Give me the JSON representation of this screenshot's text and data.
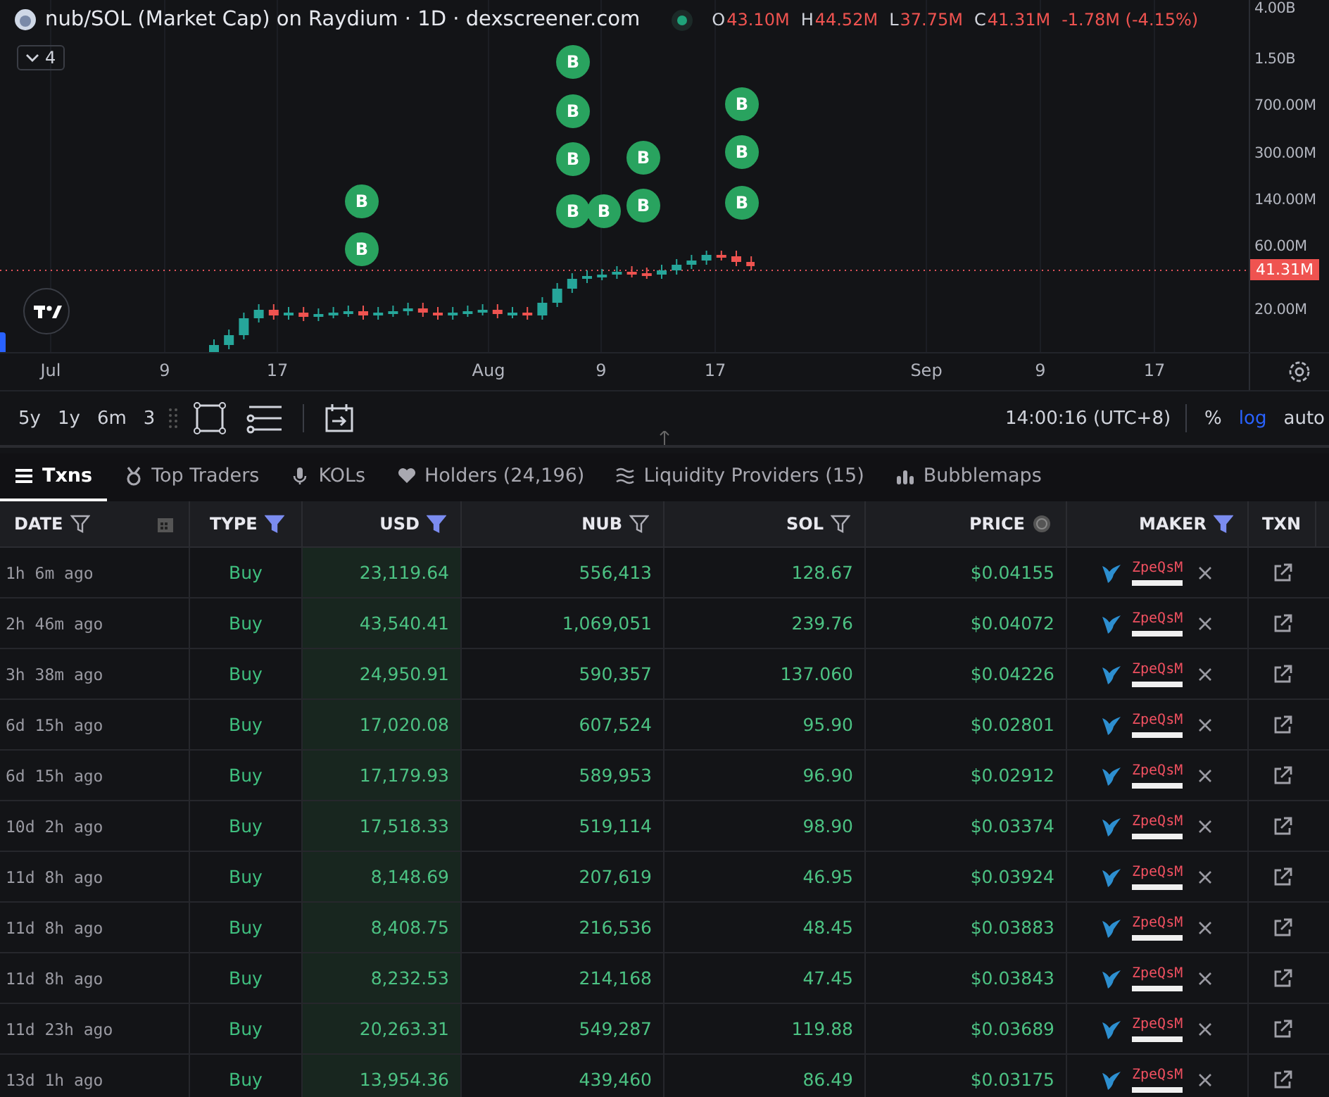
{
  "chart": {
    "legend": {
      "title": "nub/SOL (Market Cap) on Raydium · 1D · dexscreener.com",
      "live": true,
      "ohlc": [
        {
          "label": "O",
          "value": "43.10M"
        },
        {
          "label": "H",
          "value": "44.52M"
        },
        {
          "label": "L",
          "value": "37.75M"
        },
        {
          "label": "C",
          "value": "41.31M"
        }
      ],
      "change": "-1.78M (-4.15%)"
    },
    "indicators_count": "4",
    "markers": [
      {
        "label": "B"
      },
      {
        "label": "B"
      },
      {
        "label": "B"
      },
      {
        "label": "B"
      },
      {
        "label": "B"
      },
      {
        "label": "B"
      },
      {
        "label": "B"
      },
      {
        "label": "B"
      },
      {
        "label": "B"
      },
      {
        "label": "B"
      },
      {
        "label": "B"
      },
      {
        "label": "B"
      }
    ],
    "price_axis": [
      "4.00B",
      "1.50B",
      "700.00M",
      "300.00M",
      "140.00M",
      "60.00M",
      "20.00M"
    ],
    "last_price": "41.31M",
    "time_axis": [
      "Jul",
      "9",
      "17",
      "Aug",
      "9",
      "17",
      "Sep",
      "9",
      "17"
    ]
  },
  "toolbar": {
    "ranges": [
      {
        "label": "5y"
      },
      {
        "label": "1y"
      },
      {
        "label": "6m"
      },
      {
        "label": "3"
      }
    ],
    "clock": "14:00:16 (UTC+8)",
    "scale_options": [
      {
        "label": "%",
        "selected": false
      },
      {
        "label": "log",
        "selected": true
      },
      {
        "label": "auto",
        "selected": false
      }
    ]
  },
  "tabs": [
    {
      "label": "Txns",
      "selected": true
    },
    {
      "label": "Top Traders",
      "selected": false
    },
    {
      "label": "KOLs",
      "selected": false
    },
    {
      "label": "Holders (24,196)",
      "selected": false
    },
    {
      "label": "Liquidity Providers (15)",
      "selected": false
    },
    {
      "label": "Bubblemaps",
      "selected": false
    }
  ],
  "table": {
    "columns": [
      {
        "label": "DATE",
        "filter_active": false,
        "kind": "date"
      },
      {
        "label": "TYPE",
        "filter_active": true,
        "kind": "filter"
      },
      {
        "label": "USD",
        "filter_active": true,
        "kind": "filter"
      },
      {
        "label": "NUB",
        "filter_active": false,
        "kind": "filter"
      },
      {
        "label": "SOL",
        "filter_active": false,
        "kind": "filter"
      },
      {
        "label": "PRICE",
        "kind": "price"
      },
      {
        "label": "MAKER",
        "filter_active": true,
        "kind": "filter"
      },
      {
        "label": "TXN",
        "kind": "plain"
      }
    ],
    "rows": [
      {
        "date": "1h 6m ago",
        "type": "Buy",
        "usd": "23,119.64",
        "nub": "556,413",
        "sol": "128.67",
        "price": "$0.04155",
        "maker": "ZpeQsM"
      },
      {
        "date": "2h 46m ago",
        "type": "Buy",
        "usd": "43,540.41",
        "nub": "1,069,051",
        "sol": "239.76",
        "price": "$0.04072",
        "maker": "ZpeQsM"
      },
      {
        "date": "3h 38m ago",
        "type": "Buy",
        "usd": "24,950.91",
        "nub": "590,357",
        "sol": "137.060",
        "price": "$0.04226",
        "maker": "ZpeQsM"
      },
      {
        "date": "6d 15h ago",
        "type": "Buy",
        "usd": "17,020.08",
        "nub": "607,524",
        "sol": "95.90",
        "price": "$0.02801",
        "maker": "ZpeQsM"
      },
      {
        "date": "6d 15h ago",
        "type": "Buy",
        "usd": "17,179.93",
        "nub": "589,953",
        "sol": "96.90",
        "price": "$0.02912",
        "maker": "ZpeQsM"
      },
      {
        "date": "10d 2h ago",
        "type": "Buy",
        "usd": "17,518.33",
        "nub": "519,114",
        "sol": "98.90",
        "price": "$0.03374",
        "maker": "ZpeQsM"
      },
      {
        "date": "11d 8h ago",
        "type": "Buy",
        "usd": "8,148.69",
        "nub": "207,619",
        "sol": "46.95",
        "price": "$0.03924",
        "maker": "ZpeQsM"
      },
      {
        "date": "11d 8h ago",
        "type": "Buy",
        "usd": "8,408.75",
        "nub": "216,536",
        "sol": "48.45",
        "price": "$0.03883",
        "maker": "ZpeQsM"
      },
      {
        "date": "11d 8h ago",
        "type": "Buy",
        "usd": "8,232.53",
        "nub": "214,168",
        "sol": "47.45",
        "price": "$0.03843",
        "maker": "ZpeQsM"
      },
      {
        "date": "11d 23h ago",
        "type": "Buy",
        "usd": "20,263.31",
        "nub": "549,287",
        "sol": "119.88",
        "price": "$0.03689",
        "maker": "ZpeQsM"
      },
      {
        "date": "13d 1h ago",
        "type": "Buy",
        "usd": "13,954.36",
        "nub": "439,460",
        "sol": "86.49",
        "price": "$0.03175",
        "maker": "ZpeQsM"
      }
    ]
  }
}
